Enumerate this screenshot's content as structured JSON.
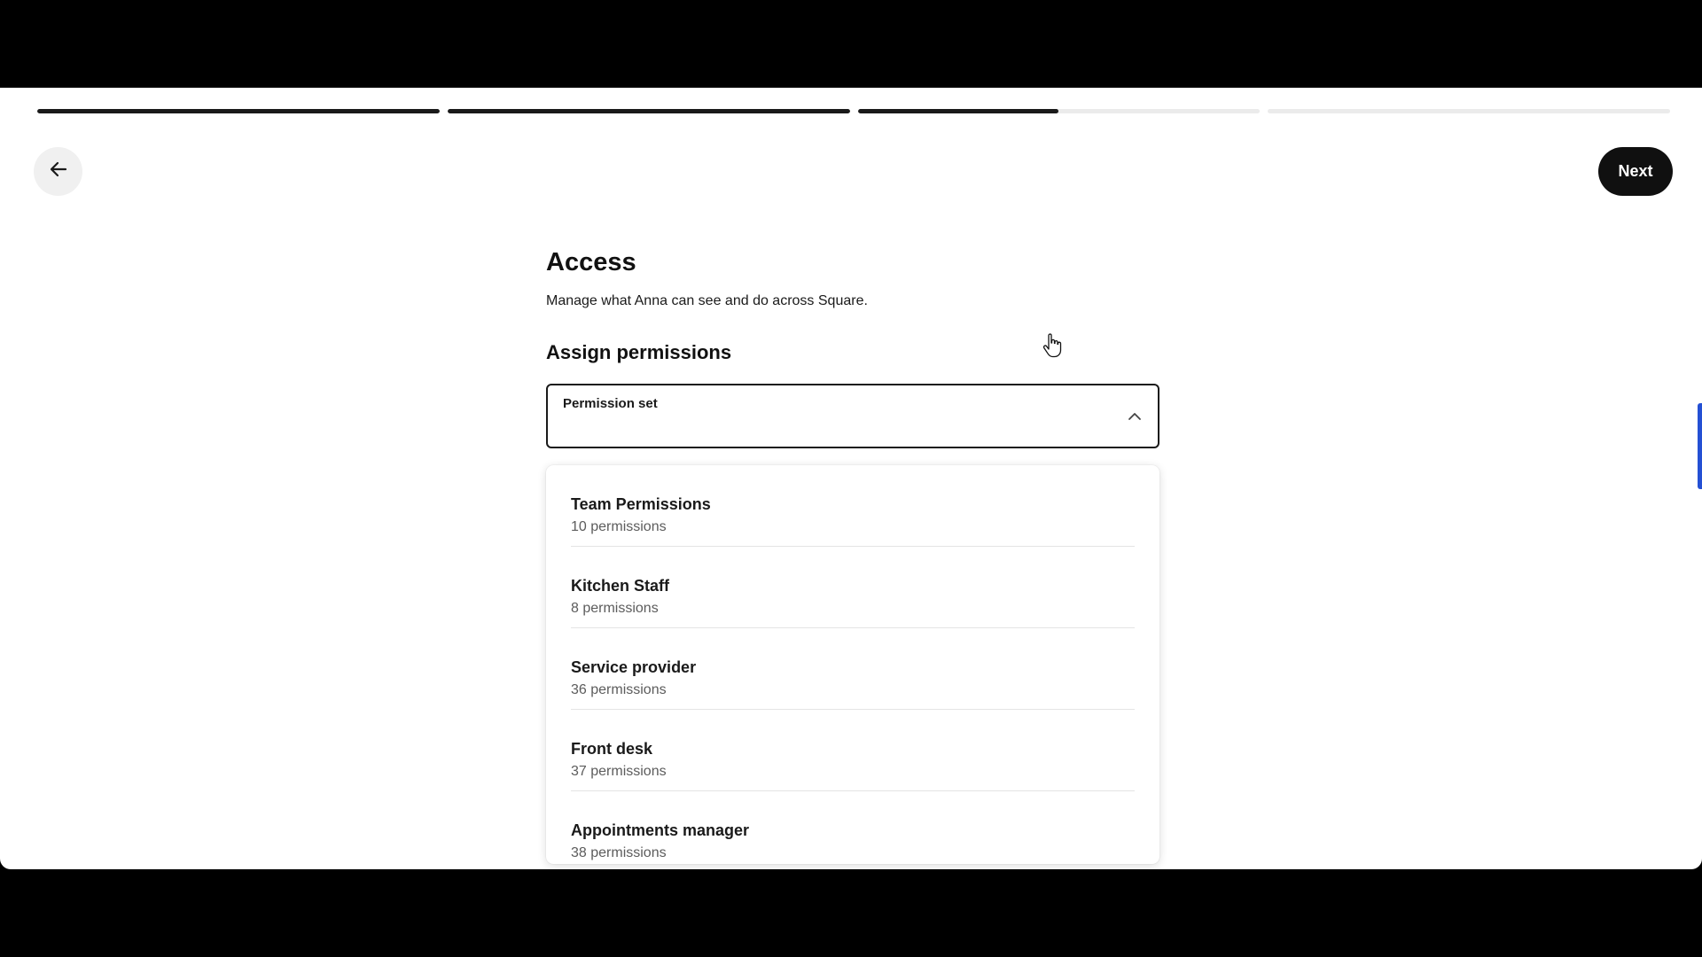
{
  "colors": {
    "background": "#000000",
    "surface": "#ffffff",
    "primary_button": "#101010",
    "progress_complete": "#1a1a1a",
    "progress_incomplete": "#ebebeb",
    "side_indicator": "#2450d4"
  },
  "progress": {
    "segments": [
      {
        "fill": 1.0
      },
      {
        "fill": 1.0
      },
      {
        "fill": 0.5
      },
      {
        "fill": 0.0
      }
    ]
  },
  "header": {
    "back_icon": "arrow-left-icon",
    "next_label": "Next"
  },
  "page": {
    "title": "Access",
    "description": "Manage what Anna can see and do across Square.",
    "section_title": "Assign permissions"
  },
  "permission_select": {
    "label": "Permission set",
    "value": "",
    "expanded": true,
    "chevron_icon": "chevron-up-icon"
  },
  "options": [
    {
      "name": "Team Permissions",
      "count": "10 permissions"
    },
    {
      "name": "Kitchen Staff",
      "count": "8 permissions"
    },
    {
      "name": "Service provider",
      "count": "36 permissions"
    },
    {
      "name": "Front desk",
      "count": "37 permissions"
    },
    {
      "name": "Appointments manager",
      "count": "38 permissions"
    }
  ],
  "cursor_icon": "hand-pointer-icon"
}
